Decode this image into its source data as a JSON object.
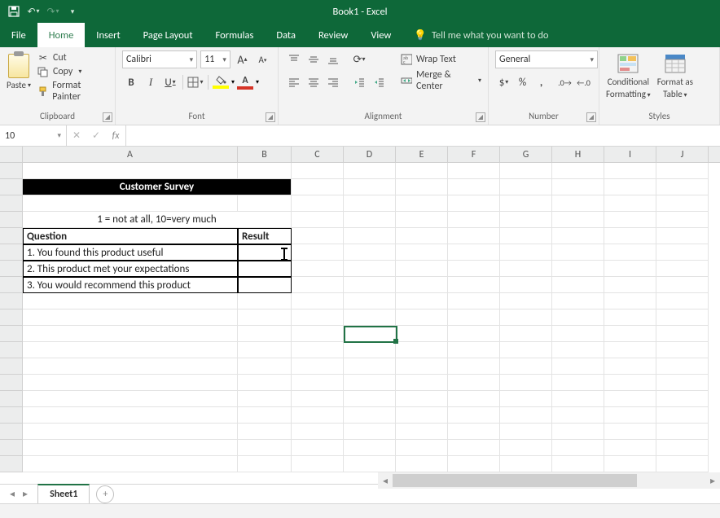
{
  "app": {
    "title": "Book1  -  Excel"
  },
  "tabs": {
    "file": "File",
    "home": "Home",
    "insert": "Insert",
    "pagelayout": "Page Layout",
    "formulas": "Formulas",
    "data": "Data",
    "review": "Review",
    "view": "View",
    "tellme": "Tell me what you want to do"
  },
  "ribbon": {
    "clipboard": {
      "label": "Clipboard",
      "paste": "Paste",
      "cut": "Cut",
      "copy": "Copy",
      "fmtpainter": "Format Painter"
    },
    "font": {
      "label": "Font",
      "name": "Calibri",
      "size": "11"
    },
    "alignment": {
      "label": "Alignment",
      "wrap": "Wrap Text",
      "merge": "Merge & Center"
    },
    "number": {
      "label": "Number",
      "format": "General"
    },
    "styles": {
      "label": "Styles",
      "conditional": "Conditional",
      "formatting": "Formatting",
      "formatas": "Format as",
      "table": "Table"
    }
  },
  "namebox": "10",
  "columns": [
    "A",
    "B",
    "C",
    "D",
    "E",
    "F",
    "G",
    "H",
    "I",
    "J"
  ],
  "sheet": {
    "title": "Customer Survey",
    "scale": "1 = not at all, 10=very much",
    "header_q": "Question",
    "header_r": "Result",
    "q1": "1. You found this product useful",
    "q2": "2. This product met your expectations",
    "q3": "3. You would recommend this product"
  },
  "sheet_tab": "Sheet1",
  "active_cell": {
    "col": "D",
    "row": 11
  }
}
